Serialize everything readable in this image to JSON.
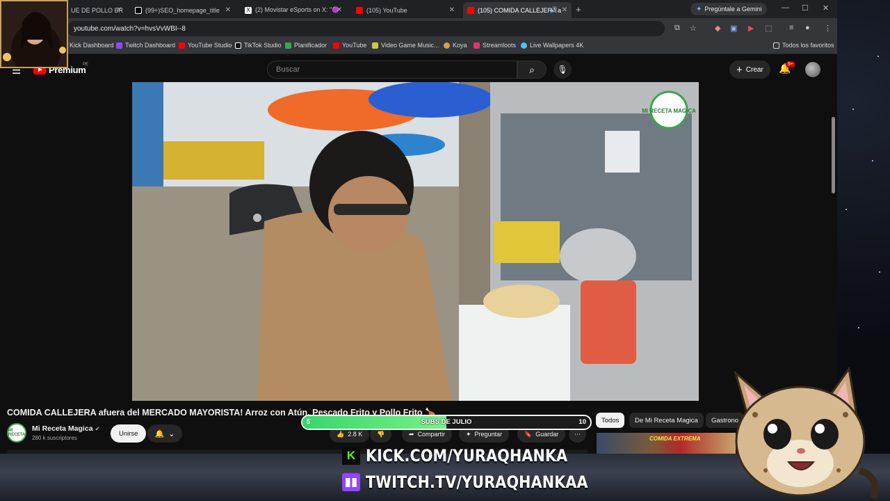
{
  "browser": {
    "tabs": [
      {
        "label": "UE DE POLLO BR",
        "icon": "youtube-red"
      },
      {
        "label": "(99+)SEO_homepage_title",
        "icon": "tiktok"
      },
      {
        "label": "(2) Movistar eSports on X: \"🟣",
        "icon": "x"
      },
      {
        "label": "(105) YouTube",
        "icon": "youtube-red"
      },
      {
        "label": "(105) COMIDA CALLEJERA a",
        "icon": "youtube-red",
        "active": true
      }
    ],
    "new_tab": "+",
    "gemini_label": "Pregúntale a Gemini",
    "url": "youtube.com/watch?v=hvsVvWBI--8",
    "bookmarks": [
      {
        "label": "Kick Dashboard",
        "color": "#53fc18"
      },
      {
        "label": "Twitch Dashboard",
        "color": "#9146ff"
      },
      {
        "label": "YouTube Studio",
        "color": "#ff0000"
      },
      {
        "label": "TikTok Studio",
        "color": "#ffffff"
      },
      {
        "label": "Planificador",
        "color": "#34a853"
      },
      {
        "label": "YouTube",
        "color": "#ff0000"
      },
      {
        "label": "Video Game Music...",
        "color": "#c9c94a"
      },
      {
        "label": "Koya",
        "color": "#d2a24c"
      },
      {
        "label": "Streamloots",
        "color": "#e0336d"
      },
      {
        "label": "Live Wallpapers 4K",
        "color": "#4fc3f7"
      }
    ],
    "all_bookmarks": "Todos los favoritos"
  },
  "youtube": {
    "brand": "Premium",
    "country": "PE",
    "search_placeholder": "Buscar",
    "create_label": "Crear",
    "notif_count": "9+",
    "video_title": "COMIDA CALLEJERA afuera del MERCADO MAYORISTA! Arroz con Atún, Pescado Frito y Pollo Frito 🍗",
    "channel": {
      "name": "Mi Receta Magica",
      "subs": "280 k suscriptores",
      "join": "Unirse",
      "avatar_text": "MI RECETA"
    },
    "actions": {
      "likes": "2.8 K",
      "share": "Compartir",
      "ask": "Preguntar",
      "save": "Guardar"
    },
    "chips": [
      "Todos",
      "De Mi Receta Magica",
      "Gastrono"
    ],
    "thumb_label": "COMIDA EXTREMA",
    "video_logo": "MI RECETA MAGICA"
  },
  "overlay": {
    "subs_goal": {
      "label": "SUBS DE JULIO",
      "current": 5,
      "goal": 10,
      "current_text": "5",
      "goal_text": "10"
    },
    "kick": "KICK.COM/YURAQHANKA",
    "twitch": "TWITCH.TV/YURAQHANKAA"
  },
  "colors": {
    "kick": "#53fc18",
    "twitch": "#9146ff",
    "progress": "#37d76a",
    "youtube_red": "#ff0000"
  }
}
